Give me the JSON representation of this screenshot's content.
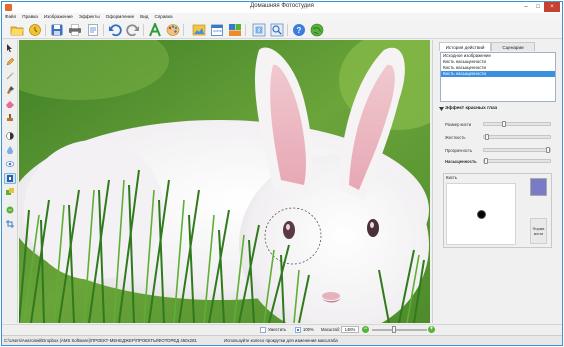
{
  "window": {
    "title": "Домашняя Фотостудия"
  },
  "menu": {
    "items": [
      "Файл",
      "Правка",
      "Изображение",
      "Эффекты",
      "Оформление",
      "Вид",
      "Справка"
    ]
  },
  "toolbar": {
    "buttons": [
      "open-icon",
      "open-recent-icon",
      "save-icon",
      "print-icon",
      "page-setup-icon",
      "export-icon",
      "undo-icon",
      "redo-icon",
      "text-icon",
      "palette-icon",
      "image-icon",
      "calendar-icon",
      "collage-icon",
      "resize-icon",
      "help-icon",
      "globe-icon"
    ]
  },
  "tools": [
    "select-arrow-icon",
    "pencil-icon",
    "magic-wand-icon",
    "brush-icon",
    "eraser-icon",
    "stamp-icon",
    "contrast-icon",
    "blur-icon",
    "red-eye-icon",
    "brightness-icon",
    "fill-bucket-icon",
    "text-tool-icon",
    "eye-dropper-icon",
    "crop-icon"
  ],
  "panel": {
    "tabs": [
      "История действий",
      "Сценарии"
    ],
    "history": [
      "Исходное изображение",
      "Кисть насыщенности",
      "Кисть насыщенности",
      "Кисть насыщенности"
    ],
    "history_selected": 3,
    "section_title": "Эффект красных глаз",
    "sliders": [
      {
        "label": "Размер кисти",
        "value": 0.3,
        "bold": false
      },
      {
        "label": "Жесткость",
        "value": 0.05,
        "bold": false
      },
      {
        "label": "Прозрачность",
        "value": 0.97,
        "bold": false
      },
      {
        "label": "Насыщенность",
        "value": 0.03,
        "bold": true
      }
    ],
    "brush_label": "Кисть",
    "brush_color": "#7b7ac7",
    "shape_label": "Форма кисти"
  },
  "zoom": {
    "fit_label": "Уместить",
    "full_label": "100%",
    "scale_label": "Масштаб:",
    "value": "148%",
    "slider_level": 0.4
  },
  "status": {
    "path": "C:\\Users\\Анатолий\\Dropbox (AMS Software)\\ПРОЕКТ-МЕНЕДЖЕР\\ПРОЕКТЫ\\ФОТОРЕД 450x281",
    "hint": "Используйте колесо прокрутки для изменения масштаба"
  },
  "colors": {
    "accent": "#3a8fe0",
    "close": "#c74133",
    "zoom_green": "#58b23a"
  }
}
